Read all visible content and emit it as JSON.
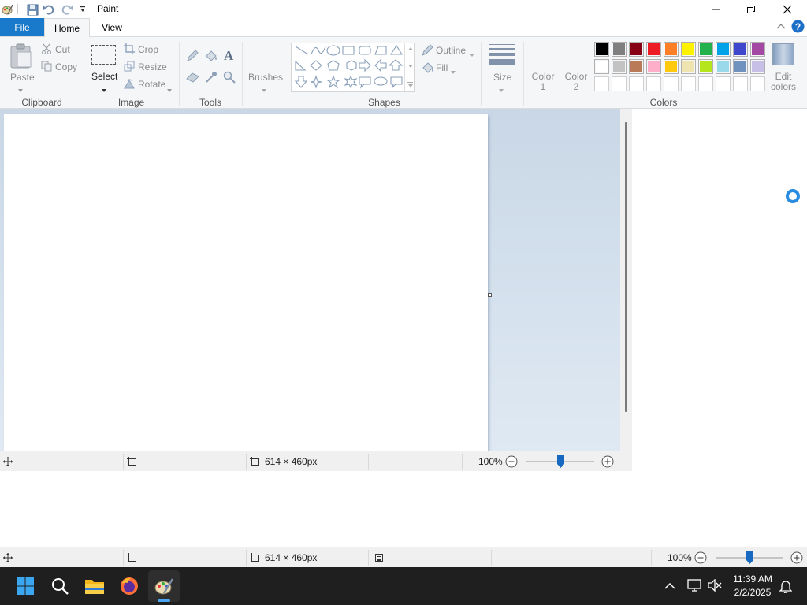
{
  "window": {
    "title": "Paint"
  },
  "tabs": {
    "file": "File",
    "home": "Home",
    "view": "View"
  },
  "clipboard": {
    "paste": "Paste",
    "cut": "Cut",
    "copy": "Copy",
    "label": "Clipboard"
  },
  "image": {
    "select": "Select",
    "crop": "Crop",
    "resize": "Resize",
    "rotate": "Rotate",
    "label": "Image"
  },
  "tools": {
    "label": "Tools"
  },
  "brushes": {
    "label": "Brushes"
  },
  "shapes": {
    "outline": "Outline",
    "fill": "Fill",
    "label": "Shapes"
  },
  "size": {
    "label": "Size"
  },
  "colors": {
    "color1": [
      "Color",
      "1"
    ],
    "color2": [
      "Color",
      "2"
    ],
    "edit": [
      "Edit",
      "colors"
    ],
    "label": "Colors",
    "palette_row1": [
      "#000000",
      "#7f7f7f",
      "#880015",
      "#ed1c24",
      "#ff7f27",
      "#fff200",
      "#22b14c",
      "#00a2e8",
      "#3f48cc",
      "#a349a4"
    ],
    "palette_row2": [
      "#ffffff",
      "#c3c3c3",
      "#b97a57",
      "#ffaec9",
      "#ffc90e",
      "#efe4b0",
      "#b5e61d",
      "#99d9ea",
      "#7092be",
      "#c8bfe7"
    ]
  },
  "status": {
    "dimensions": "614 × 460px",
    "zoom": "100%",
    "zoom_level": 0.5
  },
  "status2": {
    "dimensions": "614 × 460px",
    "zoom": "100%",
    "zoom_level": 0.5
  },
  "taskbar": {
    "time": "11:39 AM",
    "date": "2/2/2025"
  }
}
